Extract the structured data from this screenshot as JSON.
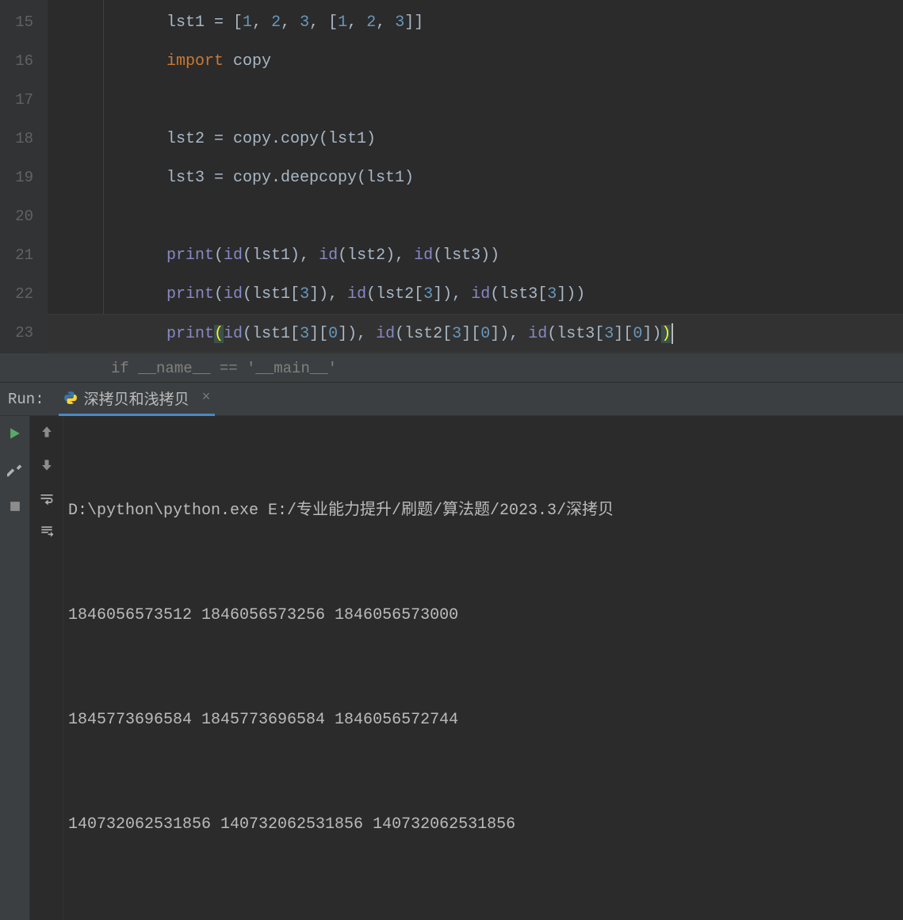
{
  "editor": {
    "line_numbers": [
      "15",
      "16",
      "17",
      "18",
      "19",
      "20",
      "21",
      "22",
      "23"
    ],
    "lines": {
      "l15": {
        "lst": "lst1",
        "eq": " = ",
        "ob": "[",
        "n1": "1",
        "c": ", ",
        "n2": "2",
        "n3": "3",
        "ob2": "[",
        "cb2": "]",
        "cb": "]"
      },
      "l16": {
        "kw": "import ",
        "mod": "copy"
      },
      "l18": {
        "lhs": "lst2 = copy.",
        "fn": "copy",
        "args": "(lst1)"
      },
      "l19": {
        "lhs": "lst3 = copy.",
        "fn": "deepcopy",
        "args": "(lst1)"
      },
      "l21": {
        "print": "print",
        "op": "(",
        "id": "id",
        "a1": "(lst1)",
        "c": ", ",
        "a2": "(lst2)",
        "a3": "(lst3)",
        "cp": ")"
      },
      "l22": {
        "print": "print",
        "op": "(",
        "id": "id",
        "a1": "(lst1[",
        "n": "3",
        "a1b": "])",
        "c": ", ",
        "a2": "(lst2[",
        "a2b": "])",
        "a3": "(lst3[",
        "a3b": "])",
        "cp": ")"
      },
      "l23": {
        "print": "print",
        "op": "(",
        "id": "id",
        "a1": "(lst1[",
        "n3": "3",
        "a1m": "][",
        "n0": "0",
        "a1b": "])",
        "c": ", ",
        "a2": "(lst2[",
        "a2m": "][",
        "a2b": "])",
        "a3": "(lst3[",
        "a3m": "][",
        "a3b": "])",
        "cp": ")"
      }
    }
  },
  "breadcrumb": "if __name__ == '__main__'",
  "run": {
    "label": "Run:",
    "tab_title": "深拷贝和浅拷贝",
    "console_lines": [
      "D:\\python\\python.exe E:/专业能力提升/刷题/算法题/2023.3/深拷贝",
      "1846056573512 1846056573256 1846056573000",
      "1845773696584 1845773696584 1846056572744",
      "140732062531856 140732062531856 140732062531856"
    ]
  }
}
